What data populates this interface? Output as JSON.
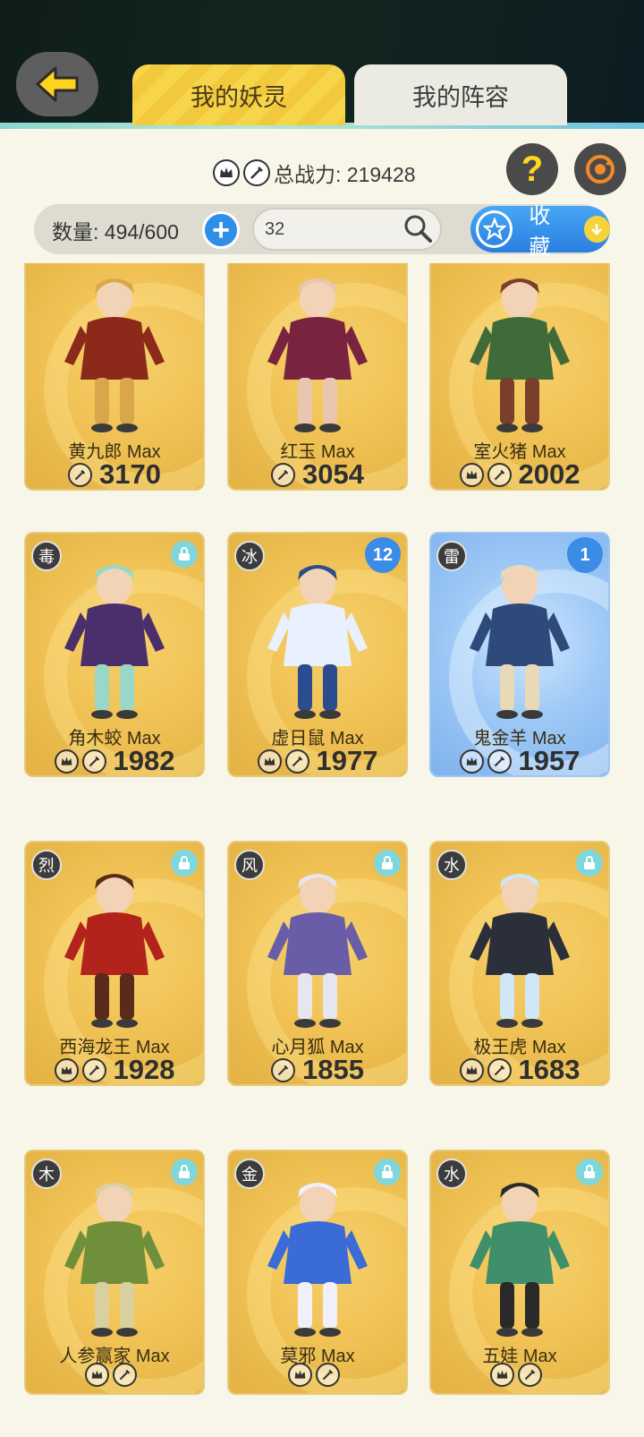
{
  "header": {
    "tabs": [
      {
        "label": "我的妖灵",
        "active": true
      },
      {
        "label": "我的阵容",
        "active": false
      }
    ]
  },
  "summary": {
    "total_power_label": "总战力: 219428",
    "count_label": "数量: 494/600",
    "search_value": "32",
    "favorite_label": "收藏"
  },
  "cards": [
    {
      "name": "黄九郎 Max",
      "power": "3170",
      "element": "",
      "crown": false,
      "level": "",
      "locked": false
    },
    {
      "name": "红玉 Max",
      "power": "3054",
      "element": "",
      "crown": false,
      "level": "",
      "locked": false
    },
    {
      "name": "室火猪 Max",
      "power": "2002",
      "element": "",
      "crown": true,
      "level": "",
      "locked": false
    },
    {
      "name": "角木蛟 Max",
      "power": "1982",
      "element": "毒",
      "crown": true,
      "level": "",
      "locked": true
    },
    {
      "name": "虚日鼠 Max",
      "power": "1977",
      "element": "冰",
      "crown": true,
      "level": "12",
      "locked": false
    },
    {
      "name": "鬼金羊 Max",
      "power": "1957",
      "element": "雷",
      "crown": true,
      "level": "1",
      "locked": false,
      "blue": true
    },
    {
      "name": "西海龙王 Max",
      "power": "1928",
      "element": "烈",
      "crown": true,
      "level": "",
      "locked": true
    },
    {
      "name": "心月狐 Max",
      "power": "1855",
      "element": "风",
      "crown": false,
      "level": "",
      "locked": true
    },
    {
      "name": "极王虎 Max",
      "power": "1683",
      "element": "水",
      "crown": true,
      "level": "",
      "locked": true
    },
    {
      "name": "人参赢家 Max",
      "power": "",
      "element": "木",
      "crown": true,
      "level": "",
      "locked": true
    },
    {
      "name": "莫邪 Max",
      "power": "",
      "element": "金",
      "crown": true,
      "level": "",
      "locked": true
    },
    {
      "name": "五娃 Max",
      "power": "",
      "element": "水",
      "crown": true,
      "level": "",
      "locked": true
    }
  ],
  "colors": {
    "accent_blue": "#2f8ee9",
    "tab_yellow": "#f7d54a",
    "card_gold": "#f1c356"
  }
}
